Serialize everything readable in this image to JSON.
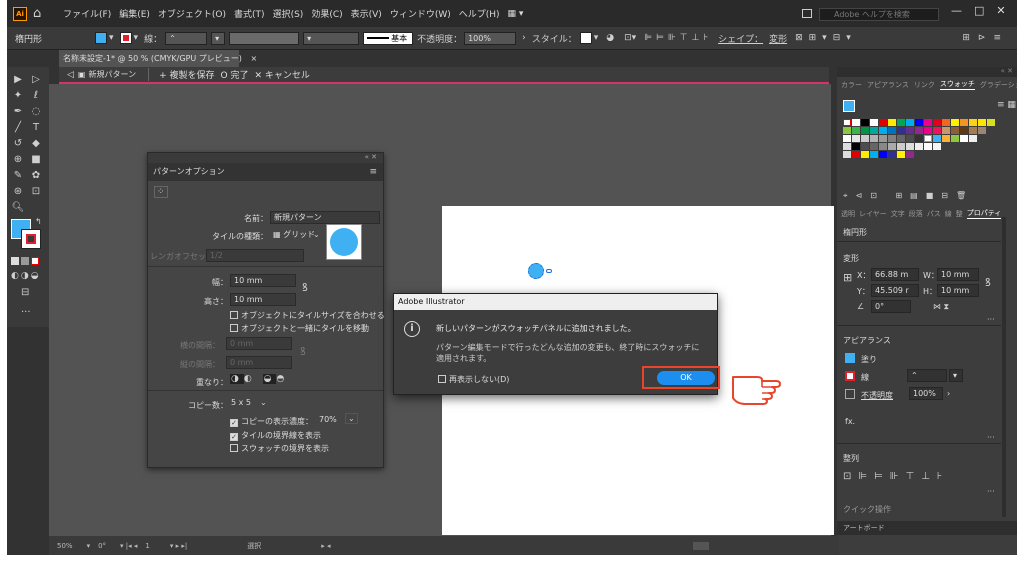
{
  "menubar": {
    "logo": "Ai",
    "items": [
      "ファイル(F)",
      "編集(E)",
      "オブジェクト(O)",
      "書式(T)",
      "選択(S)",
      "効果(C)",
      "表示(V)",
      "ウィンドウ(W)",
      "ヘルプ(H)",
      "▦ ▾"
    ],
    "search_placeholder": "Adobe ヘルプを検索",
    "window_controls": [
      "—",
      "□",
      "✕"
    ]
  },
  "control_bar": {
    "object_type": "楕円形",
    "fill_color": "#3fb1f2",
    "stroke_label": "線：",
    "stroke_profile": "基本",
    "opacity_label": "不透明度：",
    "opacity_value": "100%",
    "style_label": "スタイル：",
    "shape_label": "シェイプ：",
    "transform_label": "変形"
  },
  "document_tab": {
    "title": "名称未設定-1* @ 50 % (CMYK/GPU プレビュー)",
    "close": "×"
  },
  "isolation_bar": {
    "pattern_name": "新規パターン",
    "save_label": "+ 複製を保存",
    "done_label": "O 完了",
    "cancel_label": "✕ キャンセル"
  },
  "pattern_options": {
    "title": "パターンオプション",
    "name_label": "名前：",
    "name_value": "新規パターン",
    "tile_type_label": "タイルの種類：",
    "tile_type_value": "▦ グリッド",
    "brick_offset_label": "レンガオフセット：",
    "brick_offset_value": "1/2",
    "width_label": "幅：",
    "width_value": "10 mm",
    "height_label": "高さ：",
    "height_value": "10 mm",
    "fit_tile_label": "オブジェクトにタイルサイズを合わせる",
    "move_tile_label": "オブジェクトと一緒にタイルを移動",
    "h_spacing_label": "横の間隔：",
    "h_spacing_value": "0 mm",
    "v_spacing_label": "縦の間隔：",
    "v_spacing_value": "0 mm",
    "overlap_label": "重なり：",
    "copies_label": "コピー数：",
    "copies_value": "5 x 5",
    "dim_copies_label": "コピーの表示濃度：",
    "dim_copies_value": "70%",
    "show_tile_edge_label": "タイルの境界線を表示",
    "show_swatch_bounds_label": "スウォッチの境界を表示",
    "preview_color": "#3fb1f2"
  },
  "dialog": {
    "title": "Adobe Illustrator",
    "message": "新しいパターンがスウォッチパネルに追加されました。",
    "detail": "パターン編集モードで行ったどんな追加の変更も、終了時にスウォッチに適用されます。",
    "dont_show_label": "再表示しない(D)",
    "ok_label": "OK",
    "ok_color": "#1b8ef0",
    "highlight_color": "#e8452b"
  },
  "swatches_panel": {
    "tabs": [
      "カラー",
      "アピアランス",
      "リンク",
      "スウォッチ",
      "グラデーション"
    ],
    "active_tab": "スウォッチ"
  },
  "properties_panel": {
    "tabs": [
      "透明",
      "レイヤー",
      "文字",
      "段落",
      "パス",
      "線",
      "整",
      "プロパティ"
    ],
    "object_type": "楕円形",
    "transform_title": "変形",
    "x_label": "X：",
    "x_value": "66.88 m",
    "y_label": "Y：",
    "y_value": "45.509 r",
    "w_label": "W：",
    "w_value": "10 mm",
    "h_label": "H：",
    "h_value": "10 mm",
    "angle_value": "0°",
    "appearance_title": "アピアランス",
    "fill_label": "塗り",
    "stroke_label": "線",
    "opacity_label": "不透明度",
    "opacity_value": "100%",
    "fx_label": "fx.",
    "align_title": "整列",
    "artboard_tab": "アートボード",
    "cut_title": "クイック操作"
  },
  "status_bar": {
    "zoom": "50%",
    "angle": "0°",
    "page": "1",
    "tool": "選択"
  }
}
